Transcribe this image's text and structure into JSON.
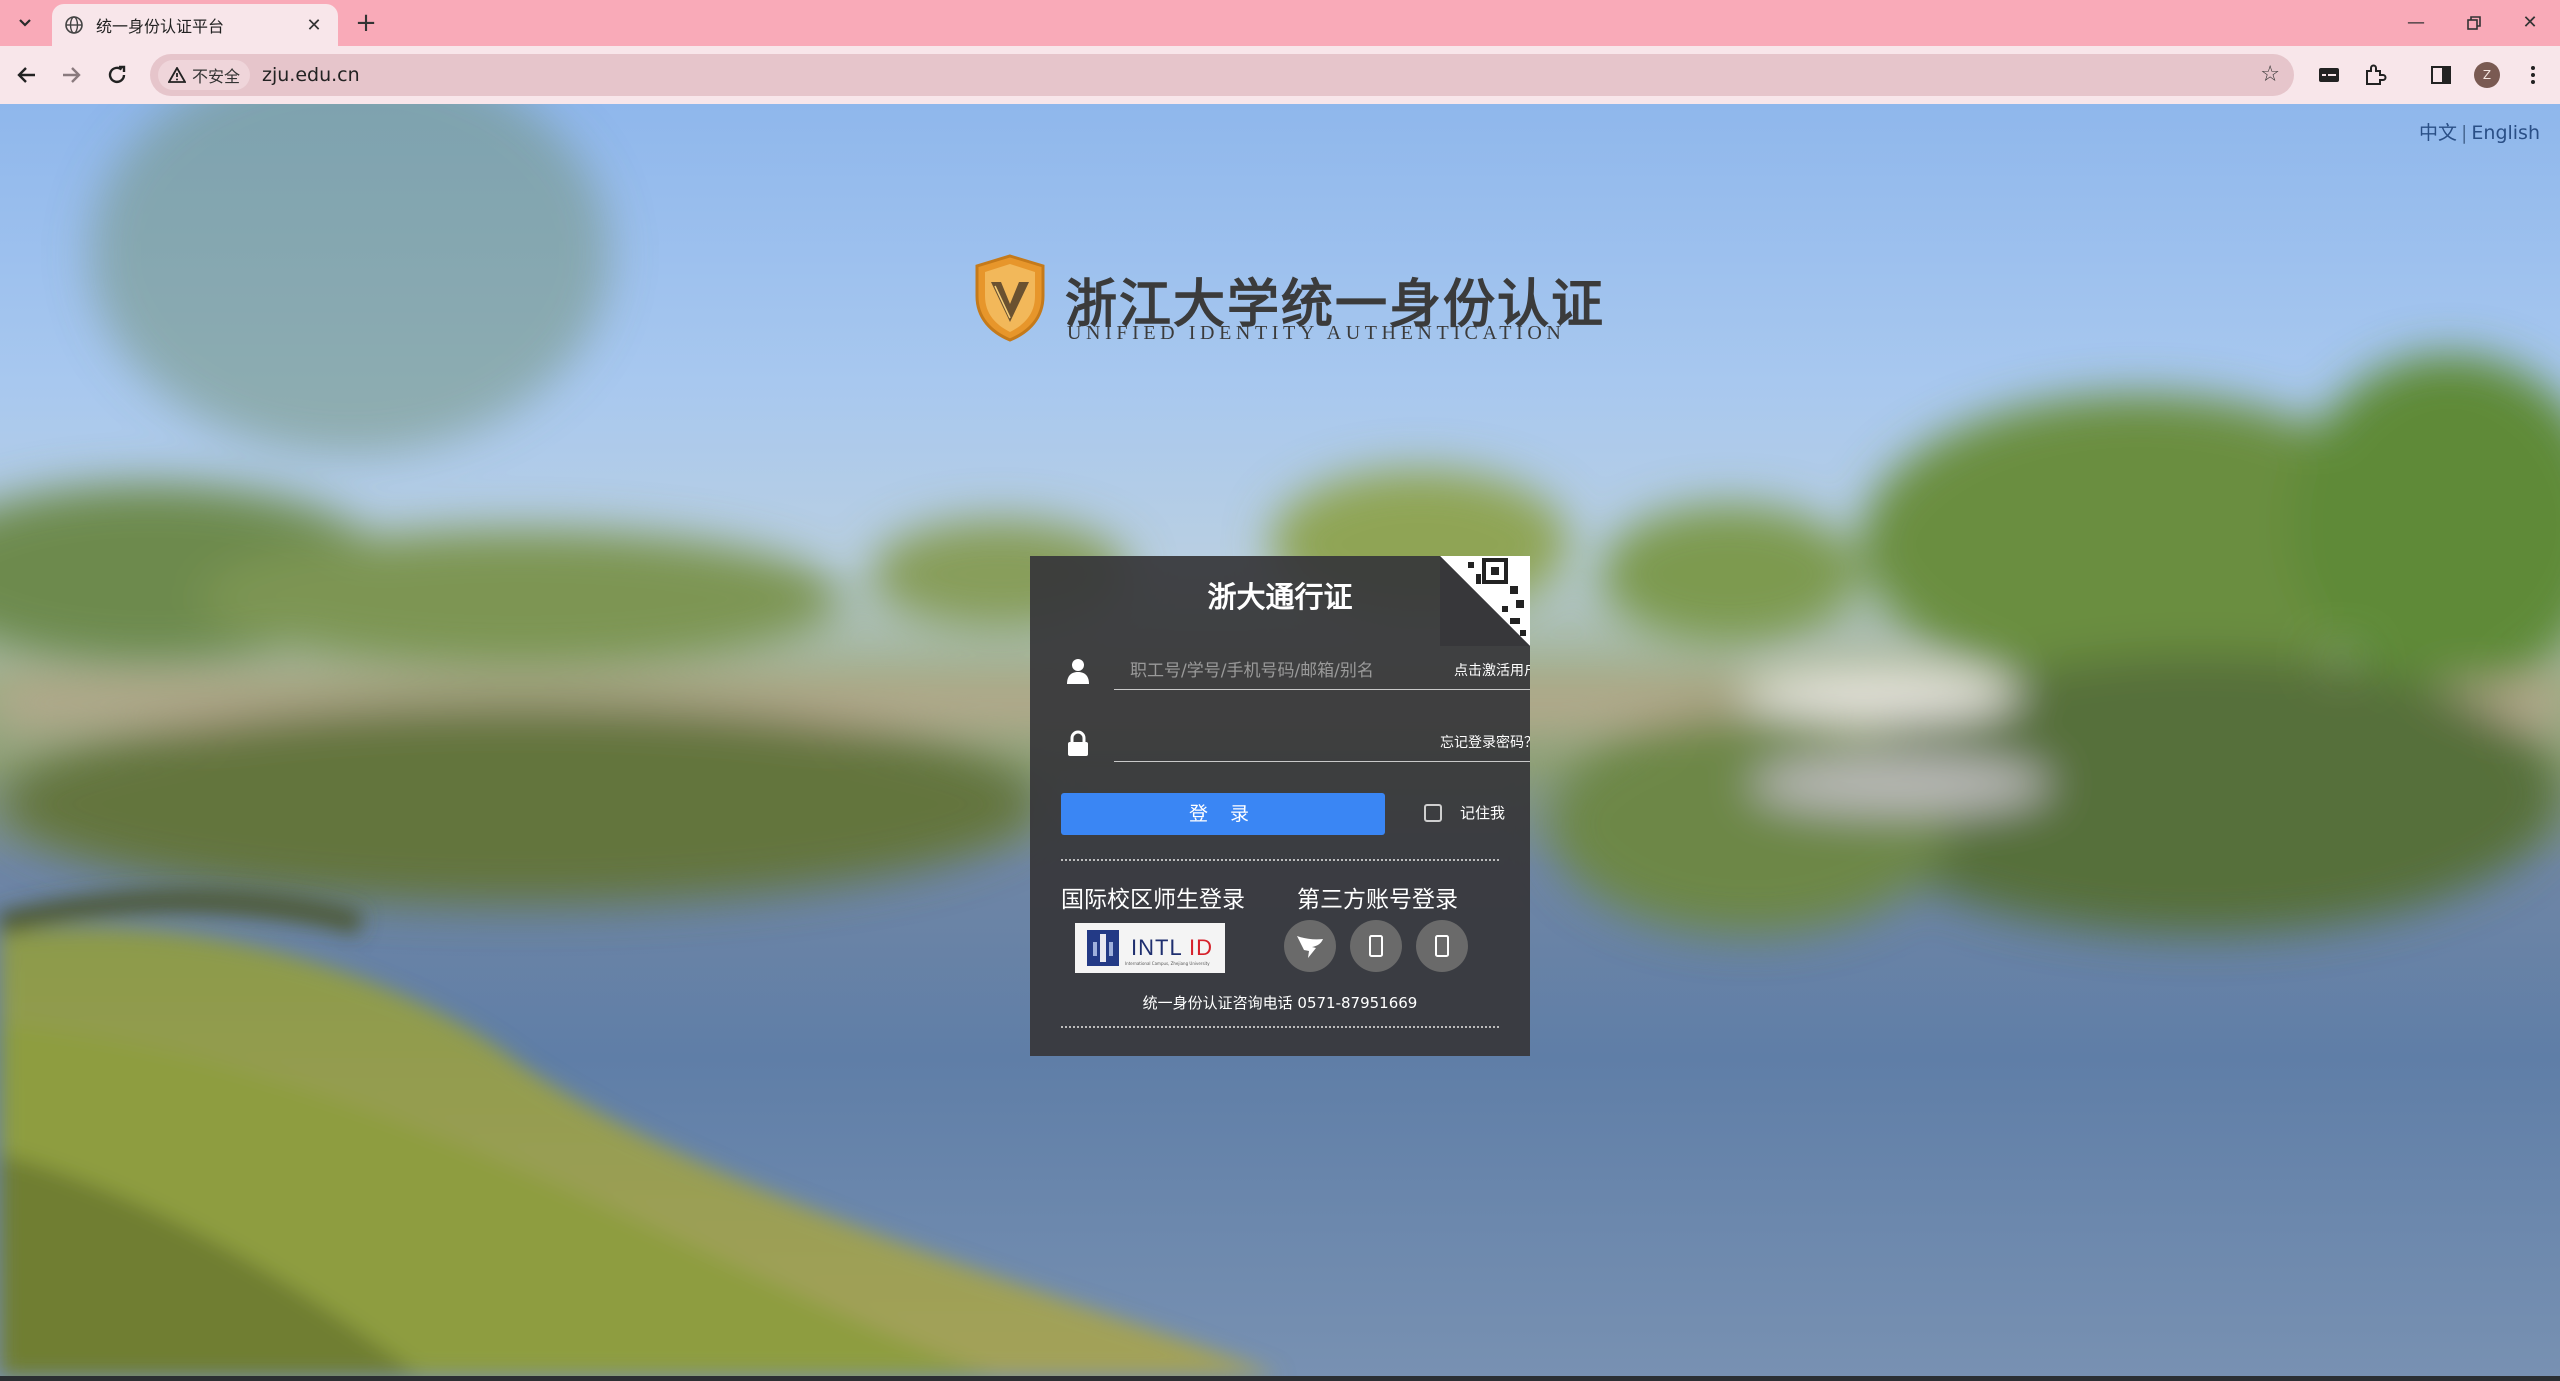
{
  "browser": {
    "tab_title": "统一身份认证平台",
    "security_label": "不安全",
    "url": "zju.edu.cn",
    "profile_initial": "Z"
  },
  "page": {
    "lang_zh": "中文",
    "lang_separator": "|",
    "lang_en": "English",
    "logo_title": "浙江大学统一身份认证",
    "logo_subtitle": "UNIFIED IDENTITY AUTHENTICATION"
  },
  "card": {
    "title": "浙大通行证",
    "username_placeholder": "职工号/学号/手机号码/邮箱/别名",
    "activate_link": "点击激活用户",
    "forgot_link": "忘记登录密码？",
    "login_button": "登 录",
    "remember_label": "记住我",
    "intl_heading": "国际校区师生登录",
    "intl_logo_text_1": "INTL",
    "intl_logo_text_2": "ID",
    "intl_logo_caption": "International Campus, Zhejiang University",
    "third_party_heading": "第三方账号登录",
    "hotline": "统一身份认证咨询电话 0571-87951669"
  },
  "colors": {
    "tabbar": "#f9aab8",
    "toolbar": "#f8e6ea",
    "card_bg": "#37373a",
    "login_button": "#3a86f4",
    "logo_shield": "#e7962b"
  }
}
